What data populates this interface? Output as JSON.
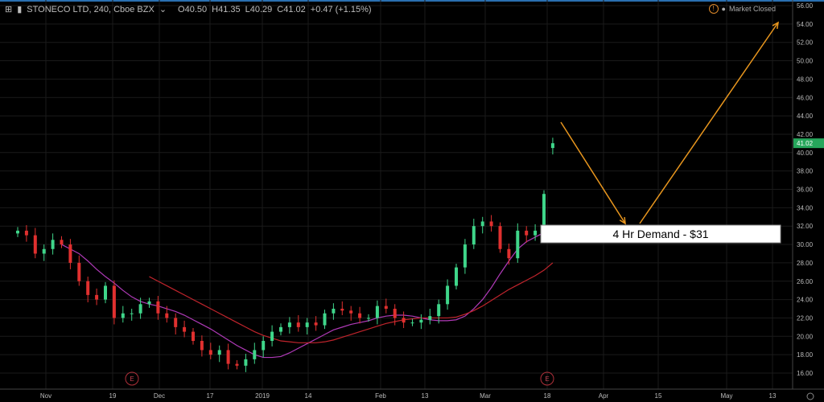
{
  "header": {
    "symbol": "STONECO LTD, 240, Cboe BZX",
    "open": "O40.50",
    "high": "H41.35",
    "low": "L40.29",
    "close": "C41.02",
    "change": "+0.47 (+1.15%)",
    "market_status": "Market Closed"
  },
  "price_axis": {
    "labels": [
      "56.00",
      "54.00",
      "52.00",
      "50.00",
      "48.00",
      "46.00",
      "44.00",
      "42.00",
      "40.00",
      "38.00",
      "36.00",
      "34.00",
      "32.00",
      "30.00",
      "28.00",
      "26.00",
      "24.00",
      "22.00",
      "20.00",
      "18.00",
      "16.00"
    ],
    "current_price": "41.02",
    "current_price_color": "#26a65b"
  },
  "time_axis": {
    "labels": [
      "Nov",
      "19",
      "Dec",
      "17",
      "2019",
      "14",
      "Feb",
      "13",
      "Mar",
      "18",
      "Apr",
      "15",
      "May",
      "13"
    ]
  },
  "earnings_markers": [
    "E",
    "E"
  ],
  "annotation": {
    "label": "4 Hr Demand - $31",
    "arrow_color": "#e8961e"
  },
  "colors": {
    "up": "#3fd68a",
    "down": "#e0302f",
    "ma_fast": "#b03ab8",
    "ma_slow": "#c0242c"
  },
  "candles_close": [
    31.5,
    31,
    29,
    29.5,
    30.5,
    30,
    28,
    26,
    24.5,
    24,
    25.5,
    22,
    22.5,
    22.5,
    23.5,
    23.8,
    22.5,
    22,
    21,
    20.5,
    19.5,
    18.5,
    18,
    18.5,
    17,
    16.8,
    17.5,
    18.5,
    19.5,
    20.5,
    21,
    21.5,
    21,
    21.5,
    21.2,
    22.5,
    23,
    22.8,
    22.5,
    22,
    22,
    23.3,
    23,
    22,
    21.5,
    21.5,
    21.8,
    22.2,
    23.5,
    25.5,
    27.5,
    30,
    32,
    32.5,
    32,
    29.5,
    28.5,
    31.5,
    31,
    31.5,
    35.5,
    41.02
  ],
  "ma_fast": {
    "start_index": 5,
    "values": [
      30,
      29.5,
      29,
      28.2,
      27.3,
      26.5,
      25.8,
      25,
      24.3,
      23.8,
      23.5,
      23.3,
      23,
      22.7,
      22.3,
      21.8,
      21.3,
      20.8,
      20.2,
      19.6,
      19,
      18.5,
      18,
      17.7,
      17.7,
      17.8,
      18.2,
      18.7,
      19.2,
      19.7,
      20.2,
      20.7,
      21,
      21.3,
      21.5,
      21.7,
      22,
      22.2,
      22.3,
      22.3,
      22.2,
      22,
      21.8,
      21.7,
      21.7,
      21.8,
      22.2,
      23,
      24,
      25.3,
      26.8,
      28.2,
      29.5,
      30.3,
      30.8,
      31.3,
      31.8
    ]
  },
  "ma_slow": {
    "start_index": 15,
    "values": [
      26.5,
      26,
      25.5,
      25,
      24.5,
      24,
      23.5,
      23,
      22.5,
      22,
      21.5,
      21,
      20.5,
      20.1,
      19.8,
      19.5,
      19.4,
      19.3,
      19.3,
      19.3,
      19.4,
      19.6,
      19.9,
      20.2,
      20.5,
      20.8,
      21.1,
      21.4,
      21.6,
      21.8,
      21.9,
      22,
      22,
      22,
      22,
      22.1,
      22.4,
      22.8,
      23.3,
      23.9,
      24.5,
      25.1,
      25.6,
      26.1,
      26.6,
      27.2,
      28
    ]
  }
}
